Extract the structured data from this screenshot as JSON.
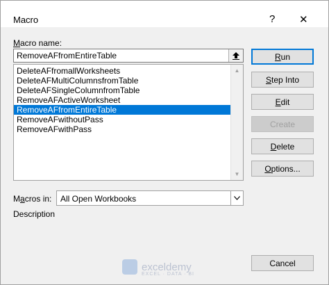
{
  "window": {
    "title": "Macro",
    "help": "?",
    "close": "✕"
  },
  "macro_name": {
    "label_prefix": "",
    "label_underlined": "M",
    "label_rest": "acro name:",
    "value": "RemoveAFfromEntireTable"
  },
  "macros": [
    {
      "name": "DeleteAFfromallWorksheets",
      "selected": false
    },
    {
      "name": "DeleteAFMultiColumnsfromTable",
      "selected": false
    },
    {
      "name": "DeleteAFSingleColumnfromTable",
      "selected": false
    },
    {
      "name": "RemoveAFActiveWorksheet",
      "selected": false
    },
    {
      "name": "RemoveAFfromEntireTable",
      "selected": true
    },
    {
      "name": "RemoveAFwithoutPass",
      "selected": false
    },
    {
      "name": "RemoveAFwithPass",
      "selected": false
    }
  ],
  "buttons": {
    "run": {
      "u": "R",
      "rest": "un"
    },
    "step_into": {
      "u": "S",
      "rest": "tep Into"
    },
    "edit": {
      "u": "E",
      "rest": "dit"
    },
    "create": {
      "text": "Create"
    },
    "delete": {
      "u": "D",
      "rest": "elete"
    },
    "options": {
      "u": "O",
      "rest": "ptions..."
    },
    "cancel": {
      "text": "Cancel"
    }
  },
  "macros_in": {
    "label_pre": "M",
    "label_u": "a",
    "label_rest": "cros in:",
    "value": "All Open Workbooks"
  },
  "description": {
    "label": "Description"
  },
  "watermark": {
    "name": "exceldemy",
    "sub": "EXCEL · DATA · BI"
  },
  "colors": {
    "selection": "#0078d7",
    "dialog_bg": "#f0f0f0"
  }
}
